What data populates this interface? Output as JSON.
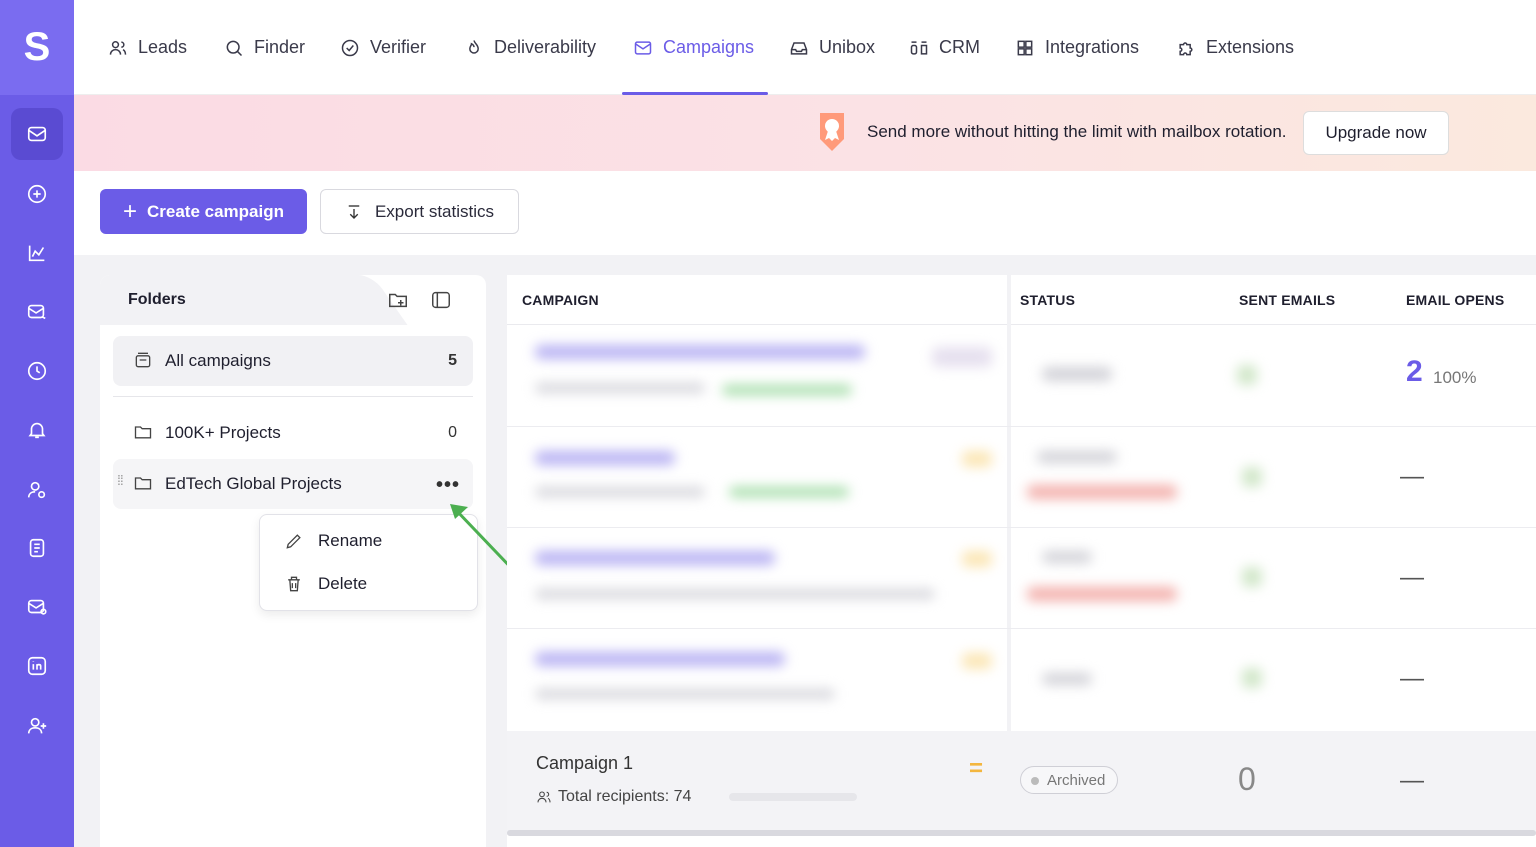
{
  "app": {
    "logo_letter": "S"
  },
  "nav": {
    "items": [
      {
        "label": "Leads",
        "icon": "users-icon"
      },
      {
        "label": "Finder",
        "icon": "search-icon"
      },
      {
        "label": "Verifier",
        "icon": "check-circle-icon"
      },
      {
        "label": "Deliverability",
        "icon": "flame-icon"
      },
      {
        "label": "Campaigns",
        "icon": "mail-icon",
        "active": true
      },
      {
        "label": "Unibox",
        "icon": "inbox-icon"
      },
      {
        "label": "CRM",
        "icon": "crm-icon"
      },
      {
        "label": "Integrations",
        "icon": "grid-icon"
      },
      {
        "label": "Extensions",
        "icon": "puzzle-icon"
      }
    ]
  },
  "sidebar": {
    "icons": [
      "mail-icon",
      "plus-circle-icon",
      "chart-icon",
      "mail-send-icon",
      "clock-icon",
      "bell-icon",
      "user-cog-icon",
      "document-icon",
      "mail-check-icon",
      "linkedin-icon",
      "user-plus-icon"
    ]
  },
  "banner": {
    "text": "Send more without hitting the limit with mailbox rotation.",
    "button": "Upgrade now"
  },
  "toolbar": {
    "create_label": "Create campaign",
    "export_label": "Export statistics"
  },
  "folders": {
    "title": "Folders",
    "all": {
      "label": "All campaigns",
      "count": "5"
    },
    "items": [
      {
        "label": "100K+ Projects",
        "count": "0"
      },
      {
        "label": "EdTech Global Projects",
        "more": "•••"
      }
    ],
    "menu": {
      "rename": "Rename",
      "delete": "Delete"
    }
  },
  "table": {
    "headers": {
      "campaign": "CAMPAIGN",
      "status": "STATUS",
      "sent": "SENT EMAILS",
      "opens": "EMAIL OPENS"
    },
    "row1_opens": {
      "value": "2",
      "pct": "100%"
    },
    "dash": "—",
    "last": {
      "name": "Campaign 1",
      "recipients": "Total recipients: 74",
      "status": "Archived",
      "sent": "0"
    }
  },
  "colors": {
    "accent": "#6b5ce7",
    "banner_from": "#fbdbe4",
    "banner_to": "#fbe9de",
    "arrow": "#4caf50"
  }
}
